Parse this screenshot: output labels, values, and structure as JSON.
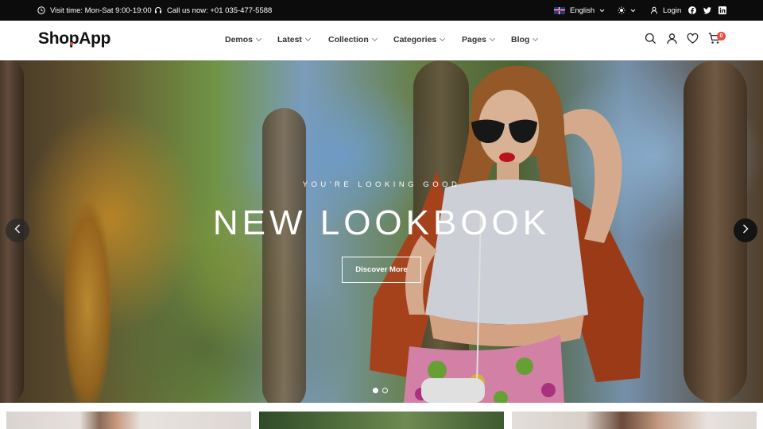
{
  "topbar": {
    "visit_time": "Visit time: Mon-Sat 9:00-19:00",
    "call_us": "Call us now: +01 035-477-5588",
    "language": "English",
    "login": "Login"
  },
  "header": {
    "logo": "ShopApp",
    "nav": [
      {
        "label": "Demos"
      },
      {
        "label": "Latest"
      },
      {
        "label": "Collection"
      },
      {
        "label": "Categories"
      },
      {
        "label": "Pages"
      },
      {
        "label": "Blog"
      }
    ],
    "cart_count": "0"
  },
  "hero": {
    "subtitle": "YOU'RE LOOKING GOOD",
    "title": "NEW LOOKBOOK",
    "button": "Discover More",
    "active_slide": 1,
    "slide_count": 2
  },
  "icons": {
    "clock": "clock-icon",
    "headset": "headset-icon",
    "flag": "uk-flag-icon",
    "theme": "sun-icon",
    "user": "user-icon",
    "facebook": "facebook-icon",
    "twitter": "twitter-icon",
    "linkedin": "linkedin-icon",
    "search": "search-icon",
    "account": "account-icon",
    "wishlist": "heart-icon",
    "cart": "cart-icon"
  },
  "colors": {
    "topbar_bg": "#0c0c0c",
    "accent": "#e74c3c",
    "text": "#111111"
  }
}
